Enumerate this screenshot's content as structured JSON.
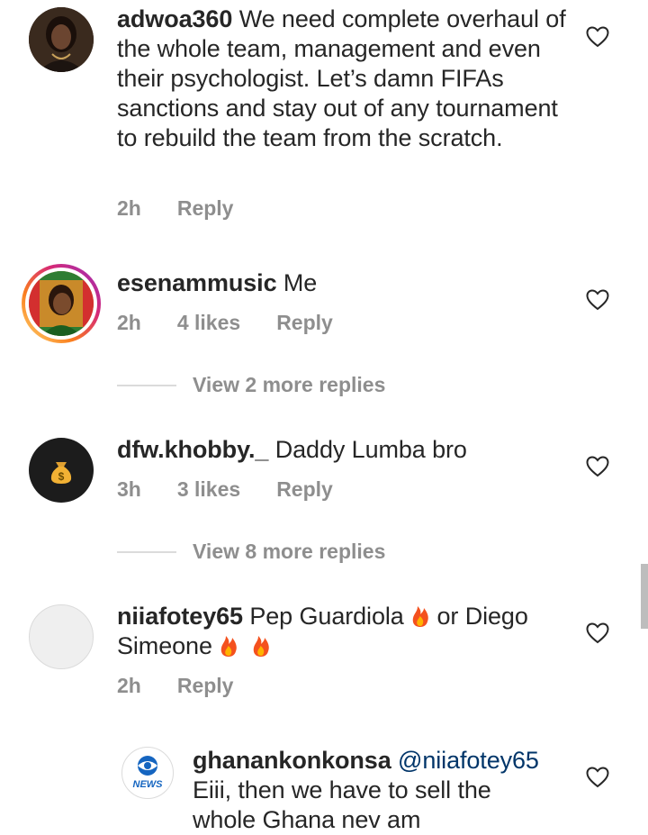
{
  "comments": [
    {
      "username": "adwoa360",
      "text": "We need complete overhaul of the whole team, management and even their psychologist. Let’s damn FIFAs sanctions and stay out of any tournament to rebuild the team from the scratch.",
      "time": "2h",
      "reply": "Reply",
      "avatar": "profile-photo-woman"
    },
    {
      "username": "esenammusic",
      "text": "Me",
      "time": "2h",
      "likes": "4 likes",
      "reply": "Reply",
      "avatar": "profile-photo-story-ring",
      "view_more": "View 2 more replies"
    },
    {
      "username": "dfw.khobby._",
      "text": "Daddy Lumba bro",
      "time": "3h",
      "likes": "3 likes",
      "reply": "Reply",
      "avatar": "money-bag-icon",
      "view_more": "View 8 more replies"
    },
    {
      "username": "niiafotey65",
      "text_part1": "Pep Guardiola",
      "text_part2": "or Diego Simeone",
      "time": "2h",
      "reply": "Reply",
      "avatar": "default-avatar"
    },
    {
      "username": "ghanankonkonsa",
      "mention": "@niiafotey65",
      "text_line1": "Eiii, then we have to sell the",
      "text_line2": "whole Ghana nev am",
      "avatar": "news-logo",
      "logo_text": "NEWS"
    }
  ],
  "icons": {
    "like": "heart-outline-icon",
    "emoji": "fire-emoji"
  },
  "colors": {
    "text": "#262626",
    "meta": "#8e8e8e",
    "mention": "#003569",
    "story_ring": "#e1306c"
  }
}
